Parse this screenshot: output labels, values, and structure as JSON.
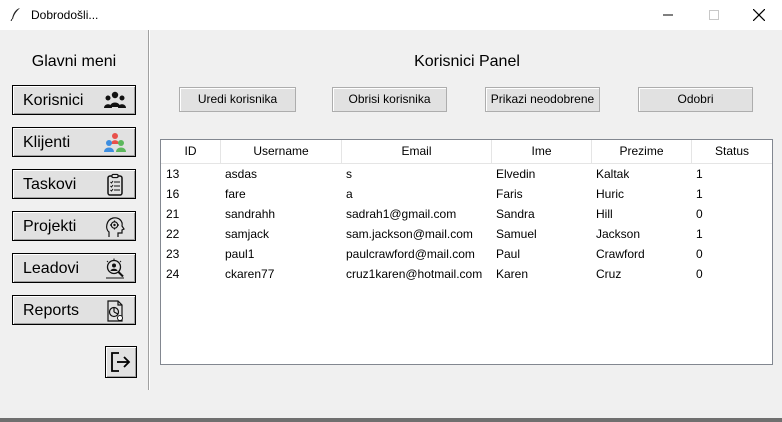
{
  "window": {
    "title": "Dobrodošli...",
    "icon": "feather-icon"
  },
  "sidebar": {
    "title": "Glavni meni",
    "items": [
      {
        "label": "Korisnici",
        "icon": "users-group-icon"
      },
      {
        "label": "Klijenti",
        "icon": "clients-colored-icon"
      },
      {
        "label": "Taskovi",
        "icon": "clipboard-checklist-icon"
      },
      {
        "label": "Projekti",
        "icon": "gear-head-icon"
      },
      {
        "label": "Leadovi",
        "icon": "magnifier-person-icon"
      },
      {
        "label": "Reports",
        "icon": "document-chart-icon"
      }
    ],
    "logout_icon": "logout-icon"
  },
  "panel": {
    "title": "Korisnici Panel",
    "buttons": {
      "edit": "Uredi korisnika",
      "delete": "Obrisi korisnika",
      "show_unapproved": "Prikazi neodobrene",
      "approve": "Odobri"
    },
    "table": {
      "columns": [
        "ID",
        "Username",
        "Email",
        "Ime",
        "Prezime",
        "Status"
      ],
      "rows": [
        [
          "13",
          "asdas",
          "s",
          "Elvedin",
          "Kaltak",
          "1"
        ],
        [
          "16",
          "fare",
          "a",
          "Faris",
          "Huric",
          "1"
        ],
        [
          "21",
          "sandrahh",
          "sadrah1@gmail.com",
          "Sandra",
          "Hill",
          "0"
        ],
        [
          "22",
          "samjack",
          "sam.jackson@mail.com",
          "Samuel",
          "Jackson",
          "1"
        ],
        [
          "23",
          "paul1",
          "paulcrawford@mail.com",
          "Paul",
          "Crawford",
          "0"
        ],
        [
          "24",
          "ckaren77",
          "cruz1karen@hotmail.com",
          "Karen",
          "Cruz",
          "0"
        ]
      ]
    }
  }
}
